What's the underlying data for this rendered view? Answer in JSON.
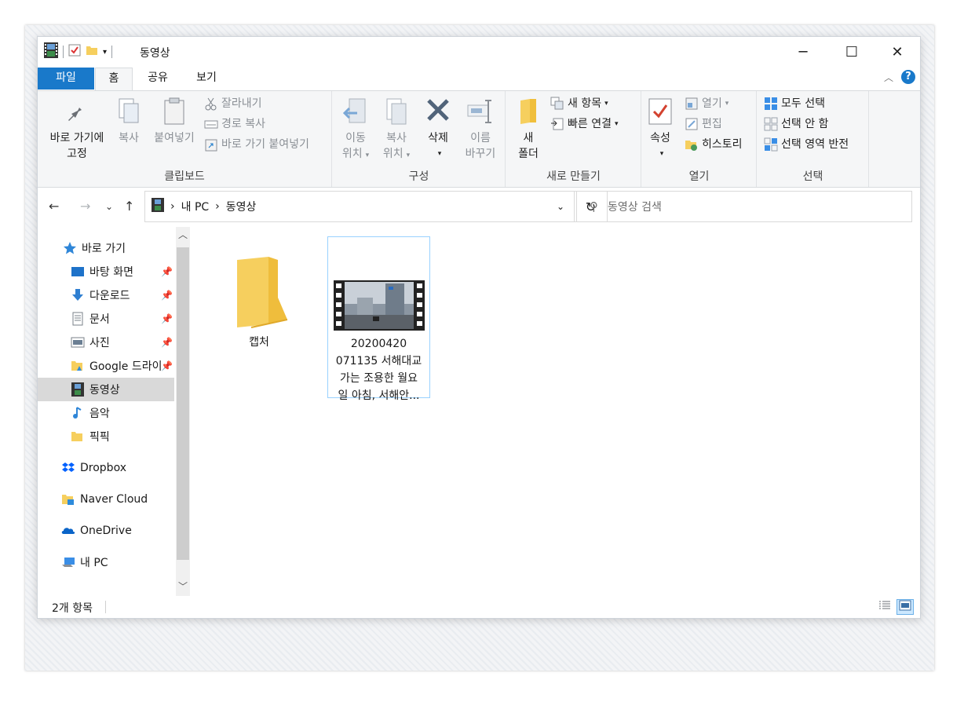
{
  "window": {
    "title": "동영상",
    "colors": {
      "accent": "#1979ca",
      "folder": "#f6cf5e",
      "selection": "#99d1ff"
    }
  },
  "tabs": {
    "file": "파일",
    "home": "홈",
    "share": "공유",
    "view": "보기"
  },
  "ribbon": {
    "clipboard": {
      "label": "클립보드",
      "pin_quick_line1": "바로 가기에",
      "pin_quick_line2": "고정",
      "copy": "복사",
      "paste": "붙여넣기",
      "cut": "잘라내기",
      "copy_path": "경로 복사",
      "paste_shortcut": "바로 가기 붙여넣기"
    },
    "organize": {
      "label": "구성",
      "move_to_line1": "이동",
      "move_to_line2": "위치",
      "copy_to_line1": "복사",
      "copy_to_line2": "위치",
      "delete": "삭제",
      "rename_line1": "이름",
      "rename_line2": "바꾸기"
    },
    "new": {
      "label": "새로 만들기",
      "new_folder_line1": "새",
      "new_folder_line2": "폴더",
      "new_item": "새 항목",
      "easy_access": "빠른 연결"
    },
    "open": {
      "label": "열기",
      "properties": "속성",
      "open": "열기",
      "edit": "편집",
      "history": "히스토리"
    },
    "select": {
      "label": "선택",
      "select_all": "모두 선택",
      "select_none": "선택 안 함",
      "invert": "선택 영역 반전"
    }
  },
  "address": {
    "crumbs": [
      "내 PC",
      "동영상"
    ],
    "search_placeholder": "동영상 검색"
  },
  "navpane": {
    "quick_access": "바로 가기",
    "items": [
      {
        "label": "바탕 화면",
        "icon": "desktop-icon",
        "pinned": true
      },
      {
        "label": "다운로드",
        "icon": "download-icon",
        "pinned": true
      },
      {
        "label": "문서",
        "icon": "document-icon",
        "pinned": true
      },
      {
        "label": "사진",
        "icon": "pictures-icon",
        "pinned": true
      },
      {
        "label": "Google 드라이",
        "icon": "google-drive-icon",
        "pinned": true
      },
      {
        "label": "동영상",
        "icon": "videos-icon",
        "pinned": false,
        "selected": true
      },
      {
        "label": "음악",
        "icon": "music-icon",
        "pinned": false
      },
      {
        "label": "픽픽",
        "icon": "folder-icon",
        "pinned": false
      }
    ],
    "roots": [
      {
        "label": "Dropbox",
        "icon": "dropbox-icon"
      },
      {
        "label": "Naver Cloud",
        "icon": "naver-cloud-icon"
      },
      {
        "label": "OneDrive",
        "icon": "onedrive-icon"
      },
      {
        "label": "내 PC",
        "icon": "this-pc-icon"
      }
    ]
  },
  "files": [
    {
      "name": "캡처",
      "type": "folder"
    },
    {
      "name_line1": "20200420",
      "name_line2": "071135 서해대교",
      "name_line3": "가는 조용한 월요",
      "name_line4": "일 아침, 서해안...",
      "type": "video",
      "selected": true
    }
  ],
  "status": {
    "count": "2개 항목"
  }
}
